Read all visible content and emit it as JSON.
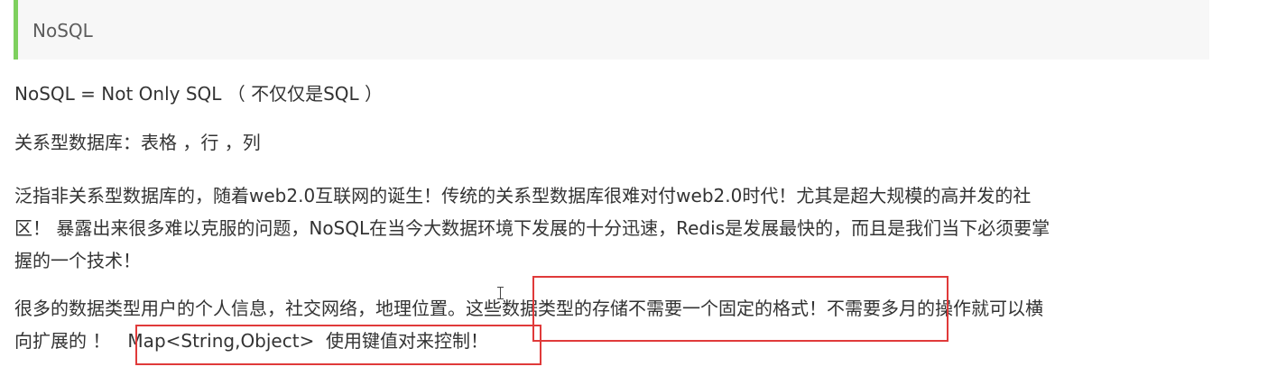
{
  "heading": {
    "title": "NoSQL"
  },
  "paragraphs": {
    "definition": "NoSQL = Not Only SQL （ 不仅仅是SQL ）",
    "relational": "关系型数据库：表格 ，行 ，列",
    "intro": [
      "泛指非关系型数据库的，随着web2.0互联网的诞生！传统的关系型数据库很难对付web2.0时代！尤其是超大规模的高并发的社",
      "区！ 暴露出来很多难以克服的问题，NoSQL在当今大数据环境下发展的十分迅速，Redis是发展最快的，而且是我们当下必须要掌",
      "握的一个技术！"
    ],
    "datatypes": [
      "很多的数据类型用户的个人信息，社交网络，地理位置。这些数据类型的存储不需要一个固定的格式！不需要多月的操作就可以横",
      "向扩展的 ！   Map<String,Object>  使用键值对来控制！"
    ]
  },
  "colors": {
    "accent_bar": "#7ed05e",
    "highlight_box": "#e03a3a",
    "heading_bg": "#f7f7f7"
  },
  "icons": {
    "cursor": "text-cursor-icon"
  }
}
